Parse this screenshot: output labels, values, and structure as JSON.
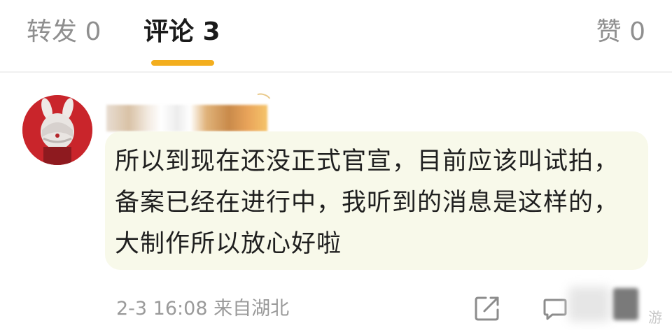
{
  "tabs": {
    "repost": "转发 0",
    "comment": "评论 3",
    "like": "赞 0"
  },
  "colors": {
    "accent": "#f3ae1e",
    "bubble_bg": "#f8f9ea",
    "avatar_bg": "#c9252b"
  },
  "comment": {
    "text": "所以到现在还没正式官宣，目前应该叫试拍，备案已经在进行中，我听到的消息是这样的，大制作所以放心好啦",
    "meta": "2-3 16:08 来自湖北"
  },
  "icons": {
    "share": "share-icon",
    "reply": "reply-icon"
  },
  "watermark": "游"
}
